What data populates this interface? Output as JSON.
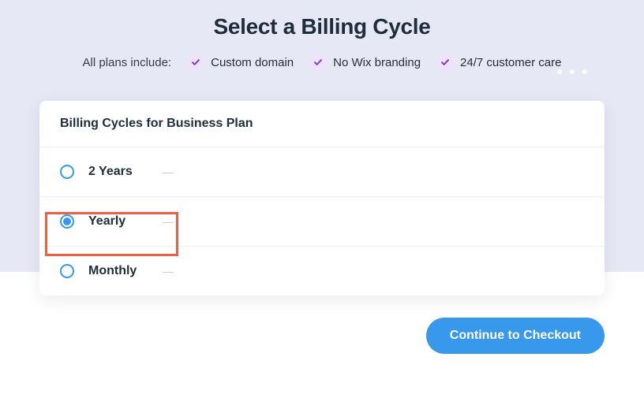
{
  "header": {
    "title": "Select a Billing Cycle",
    "leadin": "All plans include:",
    "features": [
      {
        "label": "Custom domain"
      },
      {
        "label": "No Wix branding"
      },
      {
        "label": "24/7 customer care"
      }
    ]
  },
  "card": {
    "title": "Billing Cycles for Business Plan",
    "options": [
      {
        "label": "2 Years",
        "selected": false
      },
      {
        "label": "Yearly",
        "selected": true
      },
      {
        "label": "Monthly",
        "selected": false
      }
    ]
  },
  "cta": {
    "label": "Continue to Checkout"
  }
}
